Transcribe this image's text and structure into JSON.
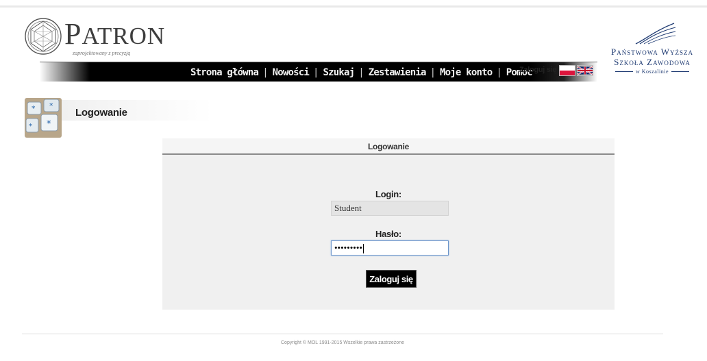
{
  "brand": {
    "name_initial": "P",
    "name_rest": "ATRON",
    "tagline": "zaprojektowany z precyzją"
  },
  "header": {
    "nav": [
      {
        "label": "Strona główna"
      },
      {
        "label": "Nowości"
      },
      {
        "label": "Szukaj"
      },
      {
        "label": "Zestawienia"
      },
      {
        "label": "Moje konto"
      },
      {
        "label": "Pomoc"
      }
    ],
    "login_link": "Zaloguj się",
    "languages": [
      "pl-flag-icon",
      "uk-flag-icon"
    ]
  },
  "university": {
    "line1": "Państwowa Wyższa",
    "line2": "Szkoła Zawodowa",
    "line3": "w Koszalinie"
  },
  "page": {
    "title": "Logowanie",
    "icon": "keyboard-keys-icon"
  },
  "form": {
    "header": "Logowanie",
    "login_label": "Login:",
    "login_value": "Student",
    "password_label": "Hasło:",
    "password_value": "•••••••••",
    "submit_label": "Zaloguj się"
  },
  "footer": {
    "copyright": "Copyright © MOL 1991-2015 Wszelkie prawa zastrzeżone"
  },
  "colors": {
    "nav_bar": "#000000",
    "panel_bg": "#f0f0f0",
    "university_blue": "#1e3a72"
  }
}
